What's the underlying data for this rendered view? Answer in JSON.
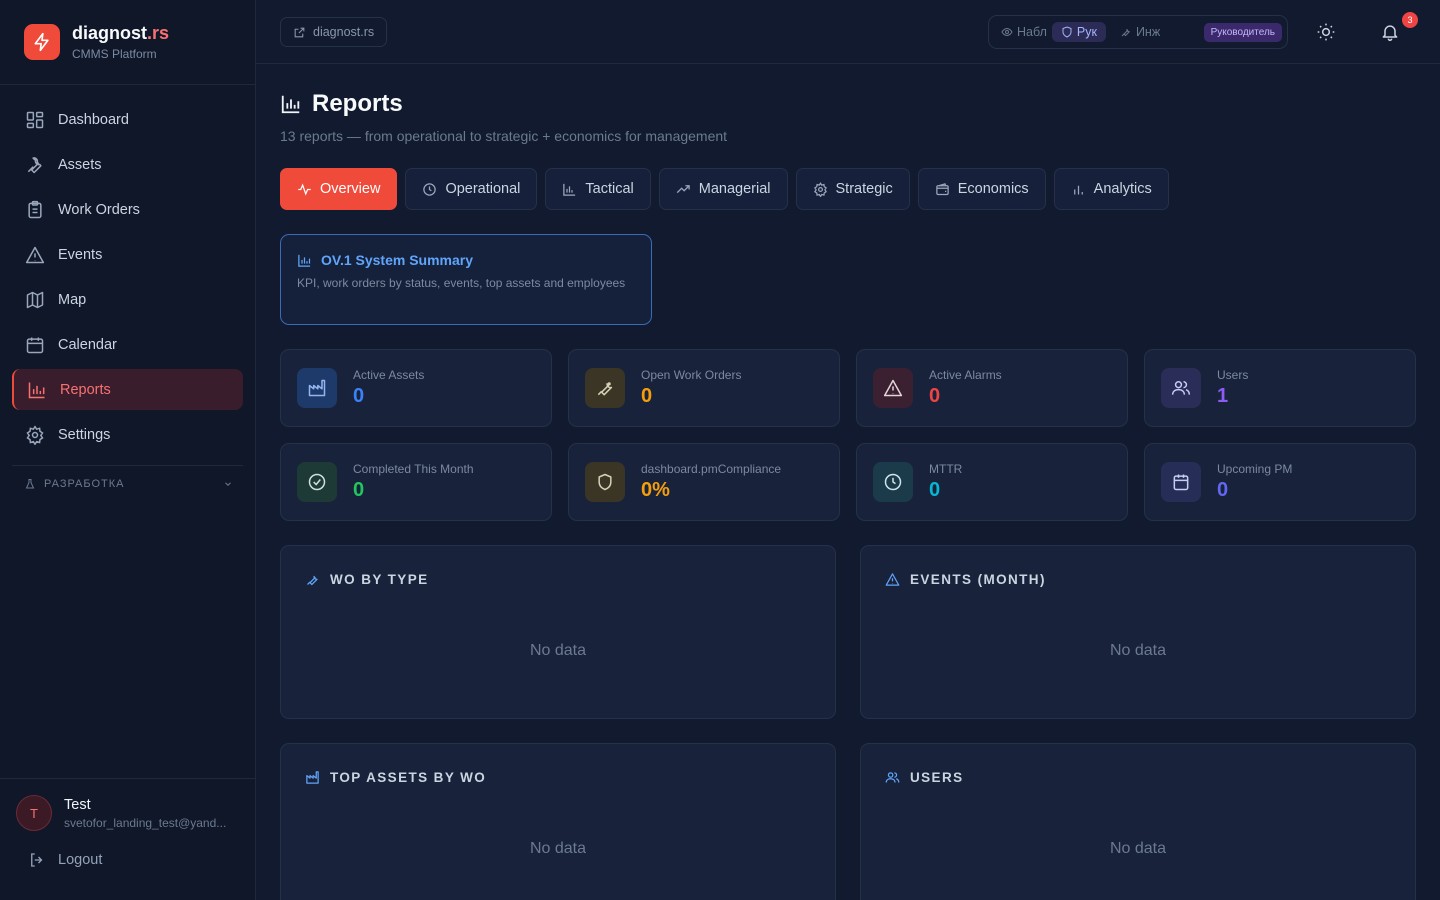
{
  "brand": {
    "name_main": "diagnost",
    "name_accent": ".rs",
    "subtitle": "CMMS Platform"
  },
  "sidebar": {
    "items": [
      {
        "label": "Dashboard",
        "icon": "dashboard-icon"
      },
      {
        "label": "Assets",
        "icon": "wrench-icon"
      },
      {
        "label": "Work Orders",
        "icon": "clipboard-icon"
      },
      {
        "label": "Events",
        "icon": "alert-triangle-icon"
      },
      {
        "label": "Map",
        "icon": "map-icon"
      },
      {
        "label": "Calendar",
        "icon": "calendar-icon"
      },
      {
        "label": "Reports",
        "icon": "bar-chart-icon",
        "active": true
      },
      {
        "label": "Settings",
        "icon": "gear-icon"
      }
    ],
    "section_label": "РАЗРАБОТКА"
  },
  "user": {
    "initial": "T",
    "name": "Test",
    "email": "svetofor_landing_test@yand...",
    "logout_label": "Logout"
  },
  "topbar": {
    "site_label": "diagnost.rs",
    "roles": [
      {
        "label": "Набл",
        "icon": "eye-icon"
      },
      {
        "label": "Рук",
        "icon": "shield-icon",
        "active": true
      },
      {
        "label": "Инж",
        "icon": "wrench-icon"
      }
    ],
    "role_badge": "Руководитель",
    "notification_count": "3"
  },
  "page": {
    "title": "Reports",
    "subtitle": "13 reports — from operational to strategic + economics for management"
  },
  "tabs": [
    {
      "label": "Overview",
      "icon": "activity-icon",
      "active": true
    },
    {
      "label": "Operational",
      "icon": "clock-icon"
    },
    {
      "label": "Tactical",
      "icon": "bar-chart-icon"
    },
    {
      "label": "Managerial",
      "icon": "trending-up-icon"
    },
    {
      "label": "Strategic",
      "icon": "gear-icon"
    },
    {
      "label": "Economics",
      "icon": "wallet-icon"
    },
    {
      "label": "Analytics",
      "icon": "bar-chart-icon"
    }
  ],
  "report_card": {
    "title": "OV.1 System Summary",
    "description": "KPI, work orders by status, events, top assets and employees"
  },
  "kpis": [
    {
      "label": "Active Assets",
      "value": "0",
      "color": "#3b82f6",
      "icon": "factory-icon"
    },
    {
      "label": "Open Work Orders",
      "value": "0",
      "color": "#f59e0b",
      "icon": "wrench-icon"
    },
    {
      "label": "Active Alarms",
      "value": "0",
      "color": "#ef4444",
      "icon": "alert-triangle-icon"
    },
    {
      "label": "Users",
      "value": "1",
      "color": "#8b5cf6",
      "icon": "users-icon"
    },
    {
      "label": "Completed This Month",
      "value": "0",
      "color": "#22c55e",
      "icon": "check-circle-icon"
    },
    {
      "label": "dashboard.pmCompliance",
      "value": "0%",
      "color": "#f59e0b",
      "icon": "shield-icon"
    },
    {
      "label": "MTTR",
      "value": "0",
      "color": "#06b6d4",
      "icon": "clock-icon"
    },
    {
      "label": "Upcoming PM",
      "value": "0",
      "color": "#6366f1",
      "icon": "calendar-icon"
    }
  ],
  "panels": [
    {
      "title": "WO BY TYPE",
      "empty": "No data",
      "icon": "wrench-icon"
    },
    {
      "title": "EVENTS (MONTH)",
      "empty": "No data",
      "icon": "alert-triangle-icon"
    },
    {
      "title": "TOP ASSETS BY WO",
      "empty": "No data",
      "icon": "factory-icon"
    },
    {
      "title": "USERS",
      "empty": "No data",
      "icon": "users-icon"
    }
  ]
}
